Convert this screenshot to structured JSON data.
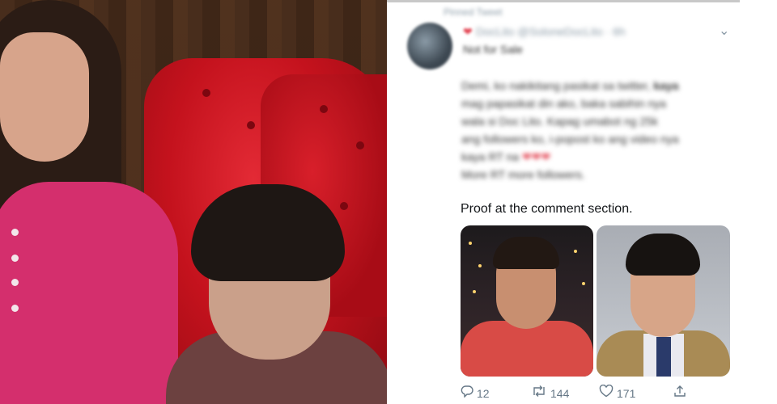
{
  "tweet": {
    "pinned_label": "Pinned Tweet",
    "display_name_heart": "❤",
    "display_name": "DocLito",
    "handle_time": "@SoloneDocLito · 6h",
    "subtitle": "Not for Sale",
    "body_lines": [
      {
        "text": "Demi, ko nakikitang pasikat sa twitter, ",
        "bold": "kaya"
      },
      {
        "text": "mag papasikat din ako, baka sabihin nya",
        "bold": ""
      },
      {
        "text": "wala si Doc Lito. Kapag umabot ng 25k",
        "bold": ""
      },
      {
        "text": "ang followers ko, i-popost ko ang video nya",
        "bold": ""
      },
      {
        "text": "kaya RT na ",
        "hearts": "❤❤❤"
      },
      {
        "text": "More RT more followers.",
        "bold": ""
      }
    ],
    "proof_text": "Proof at the comment section.",
    "actions": {
      "reply_count": "12",
      "retweet_count": "144",
      "like_count": "171"
    }
  },
  "icons": {
    "chevron": "chevron-down-icon",
    "reply": "reply-icon",
    "retweet": "retweet-icon",
    "like": "heart-icon",
    "share": "share-icon"
  },
  "colors": {
    "heart": "#e2414f",
    "meta": "#8a9aa6",
    "action": "#657786",
    "chair_red": "#c4121d",
    "shirt_pink": "#d42f6d"
  }
}
